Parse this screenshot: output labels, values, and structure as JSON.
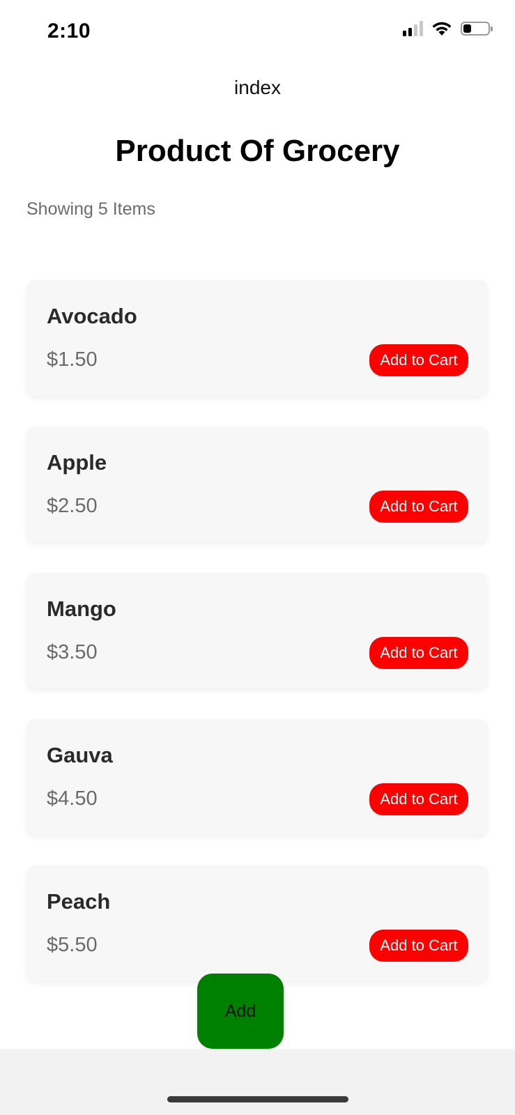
{
  "status_bar": {
    "time": "2:10",
    "icons": [
      "signal-icon",
      "wifi-icon",
      "battery-icon"
    ]
  },
  "nav": {
    "title": "index"
  },
  "page": {
    "heading": "Product Of Grocery",
    "items_count_text": "Showing 5 Items"
  },
  "products": [
    {
      "name": "Avocado",
      "price": "$1.50",
      "button_label": "Add to Cart"
    },
    {
      "name": "Apple",
      "price": "$2.50",
      "button_label": "Add to Cart"
    },
    {
      "name": "Mango",
      "price": "$3.50",
      "button_label": "Add to Cart"
    },
    {
      "name": "Gauva",
      "price": "$4.50",
      "button_label": "Add to Cart"
    },
    {
      "name": "Peach",
      "price": "$5.50",
      "button_label": "Add to Cart"
    }
  ],
  "add_button": {
    "label": "Add"
  },
  "colors": {
    "add_to_cart": "#ff0000",
    "add_button": "#008000",
    "card_background": "#f7f7f7"
  }
}
